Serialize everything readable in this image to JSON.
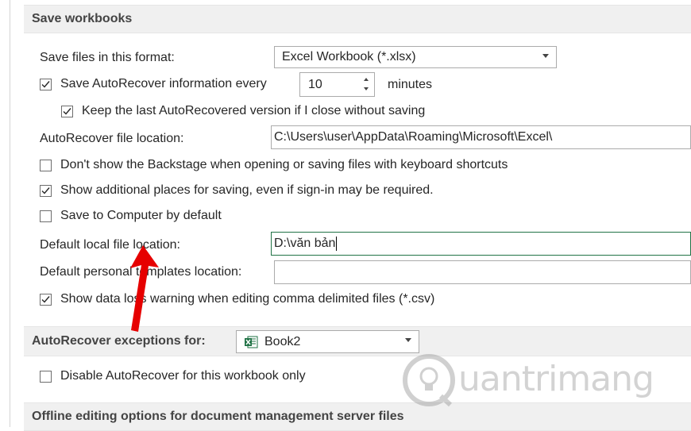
{
  "save_workbooks": {
    "header": "Save workbooks",
    "format_label": "Save files in this format:",
    "format_value": "Excel Workbook (*.xlsx)",
    "autorecover_label": "Save AutoRecover information every",
    "autorecover_checked": true,
    "autorecover_minutes": "10",
    "minutes_label": "minutes",
    "keep_last_label": "Keep the last AutoRecovered version if I close without saving",
    "keep_last_checked": true,
    "autorecover_location_label": "AutoRecover file location:",
    "autorecover_location_value": "C:\\Users\\user\\AppData\\Roaming\\Microsoft\\Excel\\",
    "dont_show_backstage_label": "Don't show the Backstage when opening or saving files with keyboard shortcuts",
    "dont_show_backstage_checked": false,
    "show_additional_label": "Show additional places for saving, even if sign-in may be required.",
    "show_additional_checked": true,
    "save_to_computer_label": "Save to Computer by default",
    "save_to_computer_checked": false,
    "default_local_label": "Default local file location:",
    "default_local_value": "D:\\văn bản",
    "default_templates_label": "Default personal templates location:",
    "default_templates_value": "",
    "data_loss_label": "Show data loss warning when editing comma delimited files (*.csv)",
    "data_loss_checked": true
  },
  "autorecover_exceptions": {
    "header": "AutoRecover exceptions for:",
    "workbook": "Book2",
    "disable_label": "Disable AutoRecover for this workbook only",
    "disable_checked": false
  },
  "offline": {
    "header": "Offline editing options for document management server files"
  },
  "watermark": {
    "text": "uantrimang"
  },
  "colors": {
    "excel_green": "#217346",
    "arrow_red": "#e60000",
    "section_bg": "#f0f0f0"
  }
}
